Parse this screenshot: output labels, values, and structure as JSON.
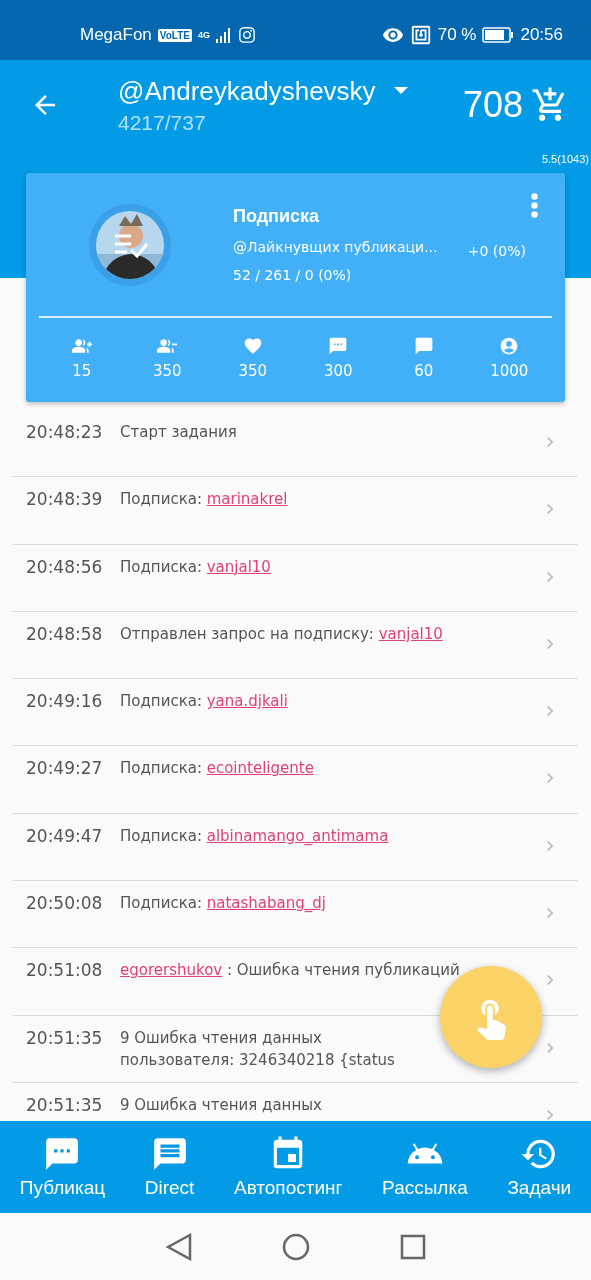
{
  "status_bar": {
    "carrier": "MegaFon",
    "volte": "VoLTE",
    "network": "4G",
    "battery": "70 %",
    "time": "20:56"
  },
  "app_bar": {
    "account": "@Andreykadyshevsky",
    "counts": "4217/737",
    "balance": "708"
  },
  "version": "5.5(1043)",
  "task_card": {
    "title": "Подписка",
    "source": "@Лайкнувщих публикаци...",
    "delta": "+0 (0%)",
    "progress": "52 / 261 / 0 (0%)",
    "stats": [
      {
        "kind": "follow",
        "value": "15"
      },
      {
        "kind": "unfollow",
        "value": "350"
      },
      {
        "kind": "like",
        "value": "350"
      },
      {
        "kind": "comment",
        "value": "300"
      },
      {
        "kind": "direct",
        "value": "60"
      },
      {
        "kind": "profile",
        "value": "1000"
      }
    ]
  },
  "log": [
    {
      "time": "20:48:23",
      "parts": [
        {
          "kind": "text",
          "text": "Старт задания"
        }
      ]
    },
    {
      "time": "20:48:39",
      "parts": [
        {
          "kind": "text",
          "text": "Подписка: "
        },
        {
          "kind": "link",
          "text": "marinakrel"
        }
      ]
    },
    {
      "time": "20:48:56",
      "parts": [
        {
          "kind": "text",
          "text": "Подписка: "
        },
        {
          "kind": "link",
          "text": "vanjal10"
        }
      ]
    },
    {
      "time": "20:48:58",
      "parts": [
        {
          "kind": "text",
          "text": "Отправлен запрос на подписку: "
        },
        {
          "kind": "link",
          "text": "vanjal10"
        }
      ]
    },
    {
      "time": "20:49:16",
      "parts": [
        {
          "kind": "text",
          "text": "Подписка: "
        },
        {
          "kind": "link",
          "text": "yana.djkali"
        }
      ]
    },
    {
      "time": "20:49:27",
      "parts": [
        {
          "kind": "text",
          "text": "Подписка: "
        },
        {
          "kind": "link",
          "text": "ecointeligente"
        }
      ]
    },
    {
      "time": "20:49:47",
      "parts": [
        {
          "kind": "text",
          "text": "Подписка: "
        },
        {
          "kind": "link",
          "text": "albinamango_antimama"
        }
      ]
    },
    {
      "time": "20:50:08",
      "parts": [
        {
          "kind": "text",
          "text": "Подписка: "
        },
        {
          "kind": "link",
          "text": "natashabang_dj"
        }
      ]
    },
    {
      "time": "20:51:08",
      "parts": [
        {
          "kind": "link",
          "text": "egorershukov"
        },
        {
          "kind": "text",
          "text": " : Ошибка чтения публикаций"
        }
      ]
    },
    {
      "time": "20:51:35",
      "parts": [
        {
          "kind": "text",
          "text": "9 Ошибка чтения данных пользователя: 3246340218 {status"
        }
      ]
    },
    {
      "time": "20:51:35",
      "parts": [
        {
          "kind": "text",
          "text": "9 Ошибка чтения данных"
        }
      ]
    }
  ],
  "bottom_nav": [
    {
      "kind": "posts",
      "label": "Публикац",
      "selected": false
    },
    {
      "kind": "direct",
      "label": "Direct",
      "selected": false
    },
    {
      "kind": "autopost",
      "label": "Автопостинг",
      "selected": false
    },
    {
      "kind": "mailing",
      "label": "Рассылка",
      "selected": false
    },
    {
      "kind": "tasks",
      "label": "Задачи",
      "selected": false
    }
  ]
}
